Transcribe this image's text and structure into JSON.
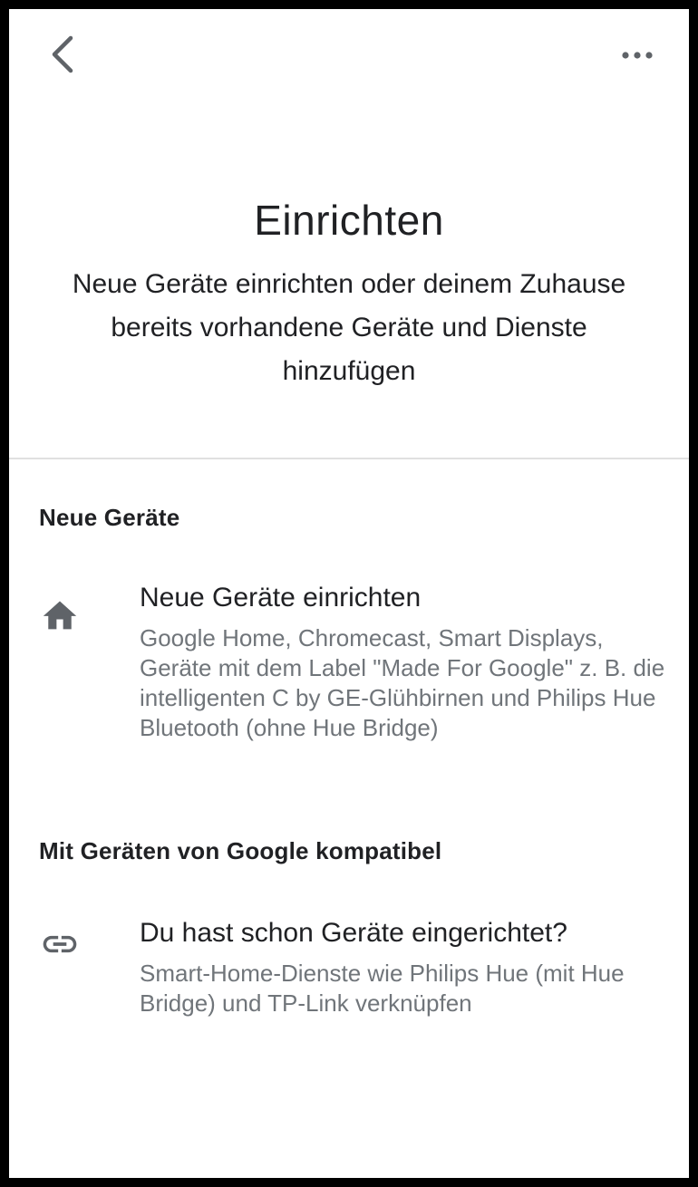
{
  "topbar": {
    "back_icon": "chevron-left-icon",
    "more_icon": "more-horizontal-icon"
  },
  "header": {
    "title": "Einrichten",
    "subtitle": "Neue Geräte einrichten oder deinem Zuhause bereits vorhandene Geräte und Dienste hinzufügen"
  },
  "sections": [
    {
      "title": "Neue Geräte",
      "item": {
        "icon": "home-icon",
        "title": "Neue Geräte einrichten",
        "description": "Google Home, Chromecast, Smart Displays, Geräte mit dem Label \"Made For Google\" z. B. die intelligenten C by GE-Glühbirnen und Philips Hue Bluetooth (ohne Hue Bridge)"
      }
    },
    {
      "title": "Mit Geräten von Google kompatibel",
      "item": {
        "icon": "link-icon",
        "title": "Du hast schon Geräte eingerichtet?",
        "description": "Smart-Home-Dienste wie Philips Hue (mit Hue Bridge) und TP-Link verknüpfen"
      }
    }
  ],
  "colors": {
    "frame": "#000000",
    "background": "#ffffff",
    "primary_text": "#202124",
    "secondary_text": "#70757a",
    "icon": "#5f6368",
    "divider": "#e0e0e0"
  }
}
